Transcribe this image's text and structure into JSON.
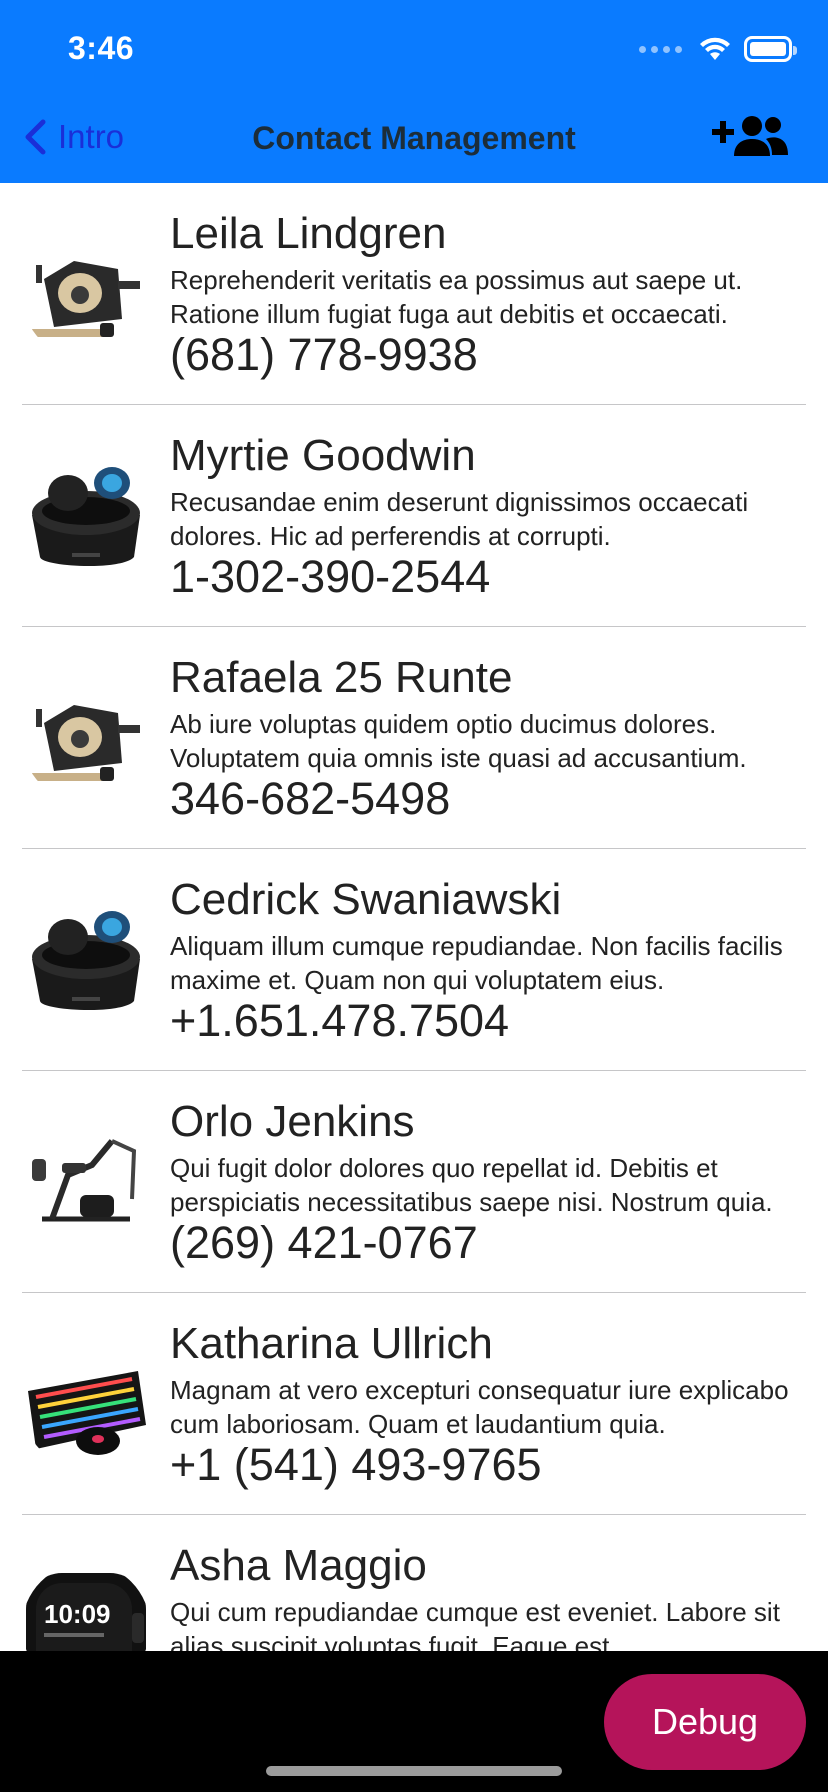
{
  "status_bar": {
    "time": "3:46"
  },
  "nav": {
    "back_label": "Intro",
    "title": "Contact Management",
    "action_icon": "add-contact-icon"
  },
  "contacts": [
    {
      "name": "Leila Lindgren",
      "description": "Reprehenderit veritatis ea possimus aut saepe ut. Ratione illum fugiat fuga aut debitis et occaecati.",
      "phone": "(681) 778-9938",
      "avatar": "exercise-bike-icon"
    },
    {
      "name": "Myrtie Goodwin",
      "description": "Recusandae enim deserunt dignissimos occaecati dolores. Hic ad perferendis at corrupti.",
      "phone": "1-302-390-2544",
      "avatar": "earbuds-icon"
    },
    {
      "name": "Rafaela 25 Runte",
      "description": "Ab iure voluptas quidem optio ducimus dolores. Voluptatem quia omnis iste quasi ad accusantium.",
      "phone": "346-682-5498",
      "avatar": "exercise-bike-icon"
    },
    {
      "name": "Cedrick Swaniawski",
      "description": "Aliquam illum cumque repudiandae. Non facilis facilis maxime et. Quam non qui voluptatem eius.",
      "phone": "+1.651.478.7504",
      "avatar": "earbuds-icon"
    },
    {
      "name": "Orlo Jenkins",
      "description": "Qui fugit dolor dolores quo repellat id. Debitis et perspiciatis necessitatibus saepe nisi. Nostrum quia.",
      "phone": "(269) 421-0767",
      "avatar": "rowing-machine-icon"
    },
    {
      "name": "Katharina Ullrich",
      "description": "Magnam at vero excepturi consequatur iure explicabo cum laboriosam. Quam et laudantium quia.",
      "phone": "+1 (541) 493-9765",
      "avatar": "keyboard-icon"
    },
    {
      "name": "Asha Maggio",
      "description": "Qui cum repudiandae cumque est eveniet. Labore sit alias suscipit voluptas fugit. Eaque est.",
      "phone": "",
      "avatar": "smartwatch-icon"
    }
  ],
  "watch_time": "10:09",
  "debug_button": {
    "label": "Debug"
  },
  "colors": {
    "header": "#0a7bff",
    "back_link": "#1a2fd8",
    "debug": "#b5145a"
  }
}
